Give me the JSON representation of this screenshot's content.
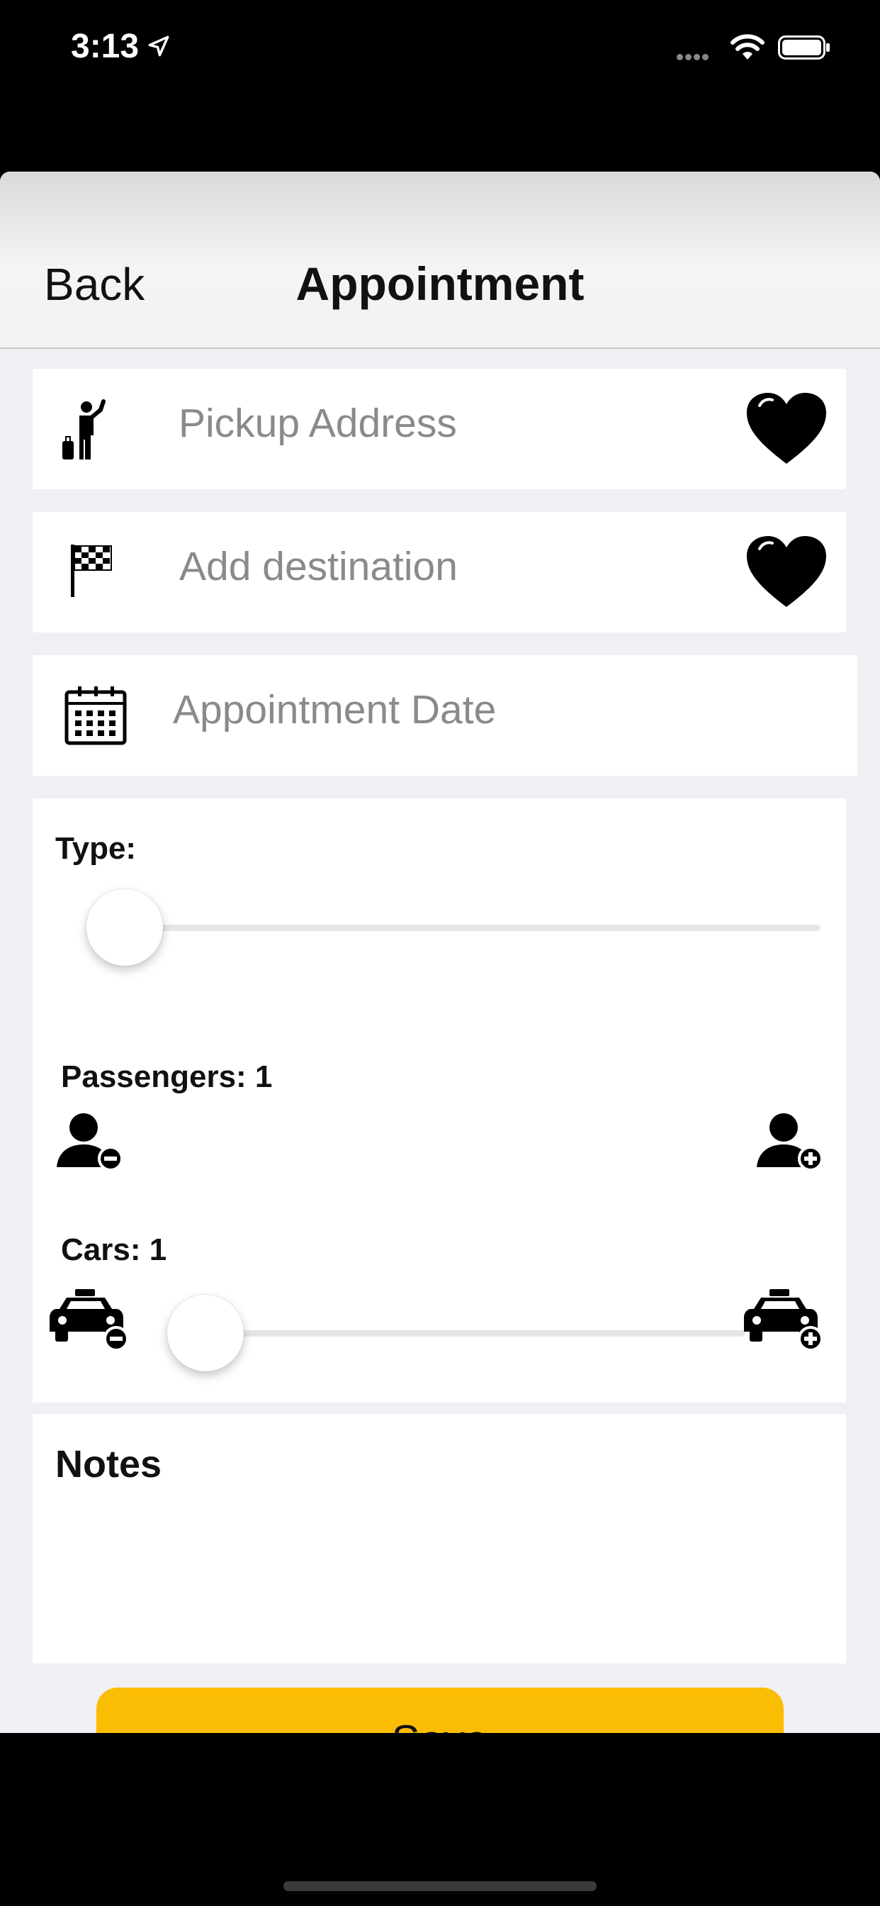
{
  "status_bar": {
    "time": "3:13"
  },
  "nav": {
    "back_label": "Back",
    "title": "Appointment"
  },
  "fields": {
    "pickup": {
      "placeholder": "Pickup Address",
      "value": ""
    },
    "destination": {
      "placeholder": "Add destination",
      "value": ""
    },
    "date": {
      "placeholder": "Appointment Date",
      "value": ""
    }
  },
  "type": {
    "label": "Type:",
    "slider_fraction": 0
  },
  "passengers": {
    "label": "Passengers: 1",
    "value": 1,
    "slider_fraction": 0
  },
  "cars": {
    "label": "Cars: 1",
    "value": 1,
    "slider_fraction": 0
  },
  "notes": {
    "title": "Notes",
    "value": ""
  },
  "save_button": {
    "label": "Save"
  },
  "icons": {
    "pickup": "hitchhiker-icon",
    "destination": "checkered-flag-icon",
    "date": "calendar-icon",
    "favorite": "heart-icon",
    "passenger_minus": "person-minus-icon",
    "passenger_plus": "person-plus-icon",
    "car_minus": "taxi-minus-icon",
    "car_plus": "taxi-plus-icon"
  },
  "colors": {
    "accent": "#fbbd03",
    "background": "#efeff4",
    "card": "#ffffff"
  }
}
